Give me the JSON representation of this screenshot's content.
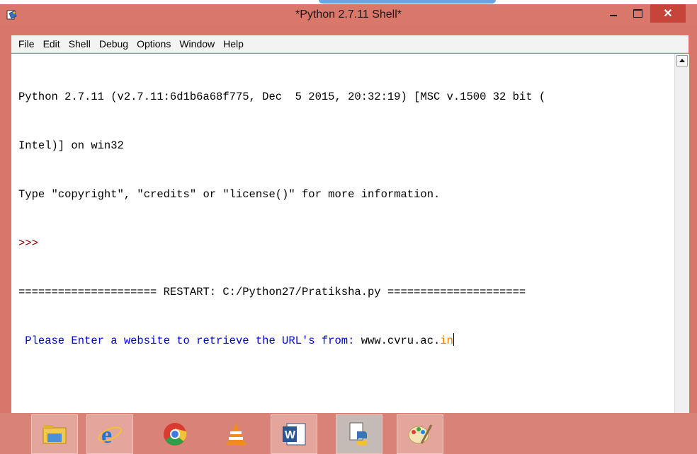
{
  "window": {
    "title": "*Python 2.7.11 Shell*",
    "controls": {
      "minimize": "minimize",
      "maximize": "maximize",
      "close": "✕"
    }
  },
  "menu": [
    "File",
    "Edit",
    "Shell",
    "Debug",
    "Options",
    "Window",
    "Help"
  ],
  "shell": {
    "banner1": "Python 2.7.11 (v2.7.11:6d1b6a68f775, Dec  5 2015, 20:32:19) [MSC v.1500 32 bit (",
    "banner2": "Intel)] on win32",
    "banner3": "Type \"copyright\", \"credits\" or \"license()\" for more information.",
    "prompt": ">>> ",
    "restart": "===================== RESTART: C:/Python27/Pratiksha.py =====================",
    "input_prompt": " Please Enter a website to retrieve the URL's from: ",
    "input_value_black": "www.cvru.ac.",
    "input_value_orange": "in"
  },
  "colors": {
    "titlebar": "#d9776b",
    "close": "#c7443a",
    "prompt": "#8b0000",
    "stdout": "#0000dd",
    "input_highlight": "#e08000"
  },
  "taskbar": {
    "items": [
      {
        "icon": "file-explorer-icon",
        "glyph": "🗂"
      },
      {
        "icon": "internet-explorer-icon",
        "glyph": "e"
      },
      {
        "icon": "chrome-icon",
        "glyph": "◉"
      },
      {
        "icon": "vlc-icon",
        "glyph": "▲"
      },
      {
        "icon": "word-icon",
        "glyph": "W"
      },
      {
        "icon": "python-icon",
        "glyph": "🐍"
      },
      {
        "icon": "paint-icon",
        "glyph": "🎨"
      }
    ]
  }
}
